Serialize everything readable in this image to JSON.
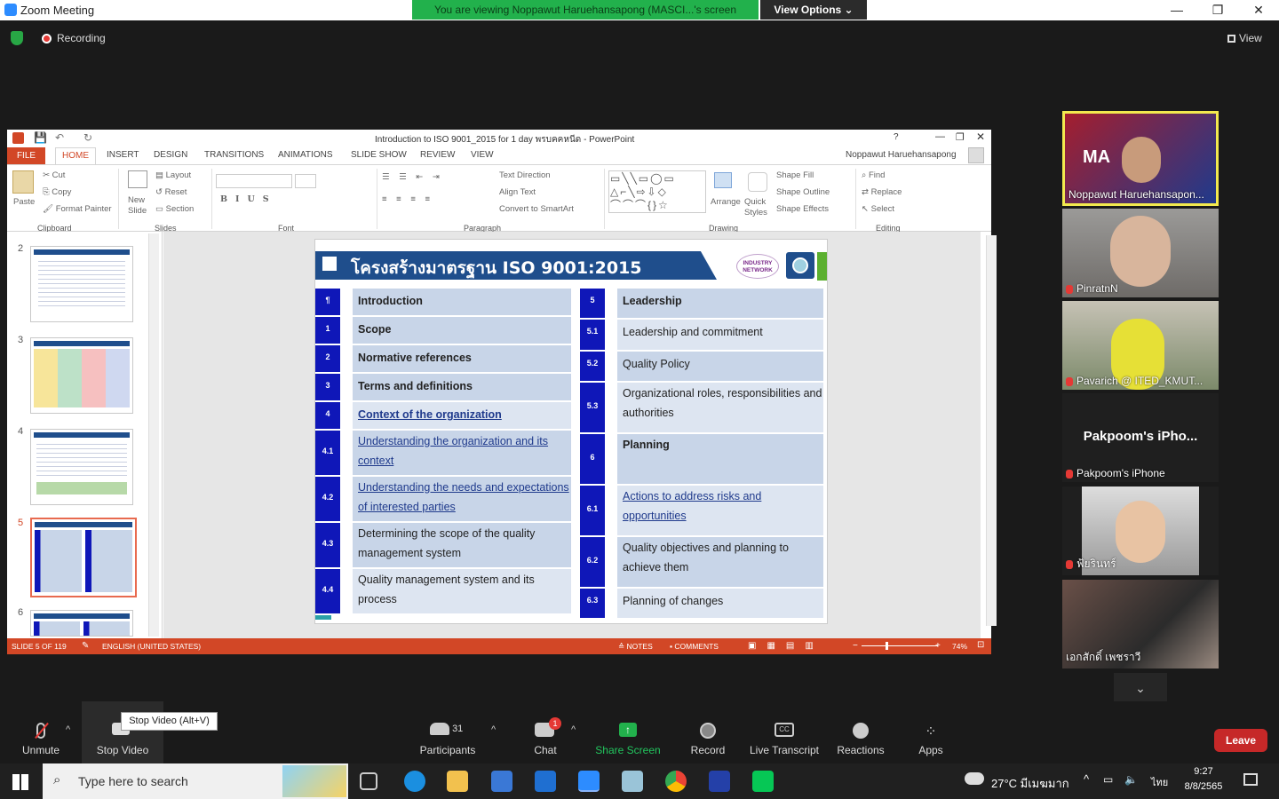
{
  "window": {
    "title": "Zoom Meeting",
    "banner": "You are viewing Noppawut Haruehansapong (MASCI...'s screen",
    "view_options": "View Options ⌄",
    "controls": [
      "—",
      "❐",
      "✕"
    ]
  },
  "meeting": {
    "recording": "Recording",
    "view": "View"
  },
  "ppt": {
    "title": "Introduction to ISO 9001_2015 for 1 day พรบคคหนีด - PowerPoint",
    "user": "Noppawut Haruehansapong",
    "tabs": [
      "FILE",
      "HOME",
      "INSERT",
      "DESIGN",
      "TRANSITIONS",
      "ANIMATIONS",
      "SLIDE SHOW",
      "REVIEW",
      "VIEW"
    ],
    "ribbon": {
      "clipboard": "Clipboard",
      "paste": "Paste",
      "cut": "Cut",
      "copy": "Copy",
      "format_painter": "Format Painter",
      "slides": "Slides",
      "new_slide": "New Slide",
      "layout": "Layout",
      "reset": "Reset",
      "section": "Section",
      "font": "Font",
      "paragraph": "Paragraph",
      "text_direction": "Text Direction",
      "align_text": "Align Text",
      "convert": "Convert to SmartArt",
      "drawing": "Drawing",
      "arrange": "Arrange",
      "quick_styles": "Quick Styles",
      "shape_fill": "Shape Fill",
      "shape_outline": "Shape Outline",
      "shape_effects": "Shape Effects",
      "editing": "Editing",
      "find": "Find",
      "replace": "Replace",
      "select": "Select"
    },
    "thumb_numbers": [
      "2",
      "3",
      "4",
      "5",
      "6"
    ],
    "status": {
      "slide": "SLIDE 5 OF 119",
      "lang": "ENGLISH (UNITED STATES)",
      "notes": "NOTES",
      "comments": "COMMENTS",
      "zoom": "74%"
    }
  },
  "slide": {
    "title": "โครงสร้างมาตรฐาน ISO 9001:2015",
    "logo": "INDUSTRY NETWORK",
    "left": [
      {
        "num": "¶",
        "text": "Introduction",
        "style": "bold"
      },
      {
        "num": "1",
        "text": "Scope",
        "style": "bold"
      },
      {
        "num": "2",
        "text": "Normative references",
        "style": "bold"
      },
      {
        "num": "3",
        "text": "Terms and definitions",
        "style": "bold"
      },
      {
        "num": "4",
        "text": "Context of the organization",
        "style": "bold link"
      },
      {
        "num": "4.1",
        "text": "Understanding the organization and its context",
        "style": "link"
      },
      {
        "num": "4.2",
        "text": "Understanding the needs and expectations of interested parties",
        "style": "link"
      },
      {
        "num": "4.3",
        "text": "Determining the scope of the quality management system",
        "style": ""
      },
      {
        "num": "4.4",
        "text": "Quality management system and its process",
        "style": ""
      }
    ],
    "right": [
      {
        "num": "5",
        "text": "Leadership",
        "style": "bold"
      },
      {
        "num": "5.1",
        "text": "Leadership and commitment",
        "style": ""
      },
      {
        "num": "5.2",
        "text": "Quality Policy",
        "style": ""
      },
      {
        "num": "5.3",
        "text": "Organizational roles, responsibilities and authorities",
        "style": ""
      },
      {
        "num": "6",
        "text": "Planning",
        "style": "bold"
      },
      {
        "num": "6.1",
        "text": "Actions to address risks and opportunities",
        "style": "link"
      },
      {
        "num": "6.2",
        "text": "Quality  objectives and planning to achieve them",
        "style": ""
      },
      {
        "num": "6.3",
        "text": "Planning of changes",
        "style": ""
      }
    ]
  },
  "participants": [
    {
      "name": "Noppawut Haruehansapon...",
      "muted": false
    },
    {
      "name": "PinratnN",
      "muted": true
    },
    {
      "name": "Pavarich @ ITED_KMUT...",
      "muted": true
    },
    {
      "name": "Pakpoom's iPhone",
      "muted": true,
      "big_label": "Pakpoom's iPho..."
    },
    {
      "name": "ฟ้ยรินทร์",
      "muted": true
    },
    {
      "name": "เอกสักดิ์ เพชราวี",
      "muted": false
    }
  ],
  "toolbar": {
    "unmute": "Unmute",
    "stop_video": "Stop Video",
    "tooltip": "Stop Video (Alt+V)",
    "participants": "Participants",
    "participant_count": "31",
    "chat": "Chat",
    "chat_badge": "1",
    "share": "Share Screen",
    "record": "Record",
    "live": "Live Transcript",
    "reactions": "Reactions",
    "apps": "Apps",
    "leave": "Leave"
  },
  "taskbar": {
    "search": "Type here to search",
    "weather": "27°C มีเมฆมาก",
    "lang": "ไทย",
    "time": "9:27",
    "date": "8/8/2565"
  }
}
